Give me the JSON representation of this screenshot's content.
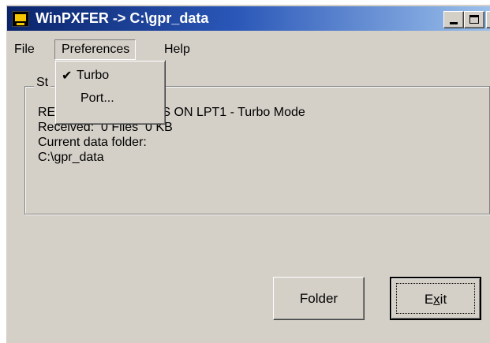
{
  "window": {
    "title": "WinPXFER -> C:\\gpr_data"
  },
  "menubar": {
    "file": "File",
    "preferences": "Preferences",
    "help": "Help"
  },
  "preferences_menu": {
    "items": [
      {
        "label": "Turbo",
        "checked": true
      },
      {
        "label": "Port...",
        "checked": false
      }
    ]
  },
  "status": {
    "legend": "St",
    "line1": "RE                IVE FILES ON LPT1 - Turbo Mode",
    "line2": "Received:  0 Files  0 KB",
    "line3": "Current data folder:",
    "line4": "C:\\gpr_data"
  },
  "buttons": {
    "folder": "Folder",
    "exit": "Exit"
  },
  "icons": {
    "check": "✔",
    "close": "✕"
  },
  "colors": {
    "title_gradient_start": "#0a246a",
    "title_gradient_end": "#a6caf0",
    "face": "#d4d0c8"
  }
}
